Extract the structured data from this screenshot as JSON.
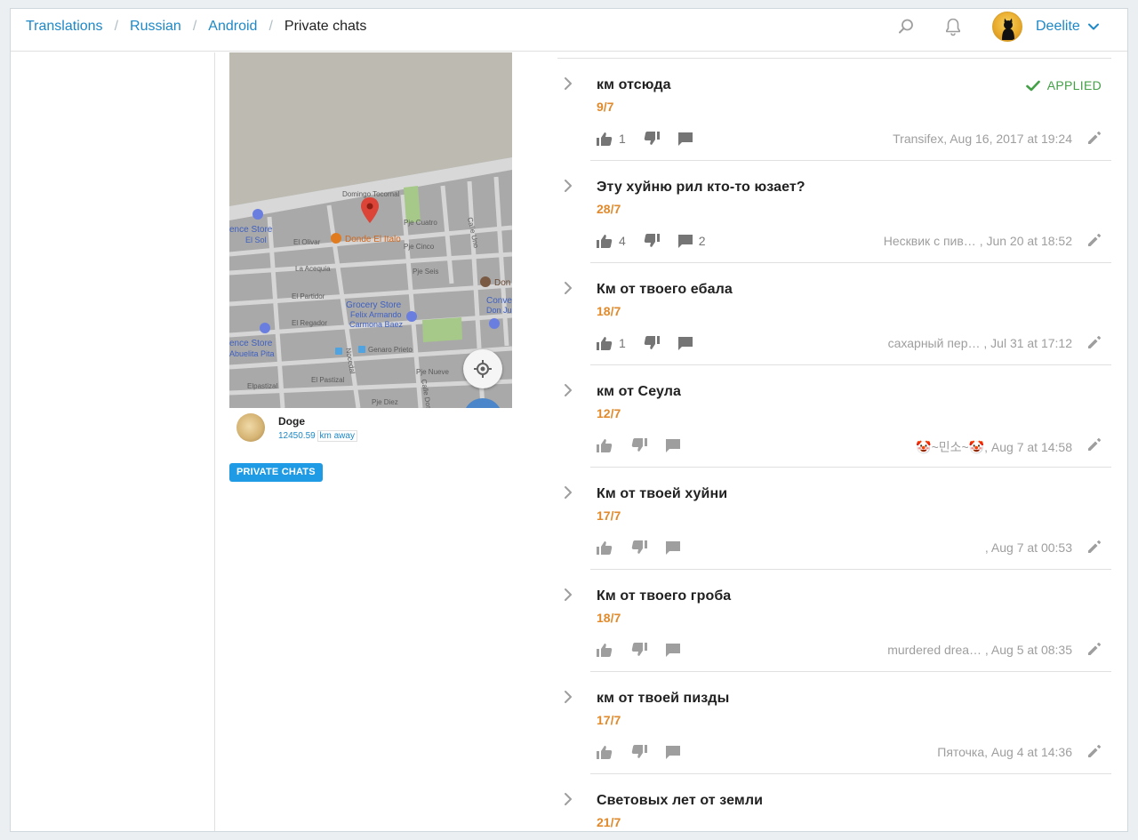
{
  "breadcrumb": {
    "items": [
      "Translations",
      "Russian",
      "Android"
    ],
    "current": "Private chats"
  },
  "header": {
    "search_icon": "search-icon",
    "notifications_icon": "bell-icon",
    "username": "Deelite"
  },
  "screenshot": {
    "map_labels": [
      "Domingo Tocornal",
      "Pje Cuatro",
      "ence Store",
      "El Sol",
      "El Olivar",
      "Donde El Italo",
      "Pje Cinco",
      "La Acequia",
      "Pje Seis",
      "Don",
      "El Partidor",
      "Conve",
      "Don Ju",
      "Grocery Store",
      "Felix Armando",
      "Carmona Baez",
      "El Regador",
      "ence Store",
      "Abuelita Pita",
      "Genaro Prieto",
      "Pje Nueve",
      "El Pastizal",
      "Elpastizal",
      "Pje Diez",
      "Calle Uno",
      "Calle Dos",
      "Nocedal"
    ],
    "contact_name": "Doge",
    "distance": "12450.59",
    "distance_unit": "km away"
  },
  "tag": "PRIVATE CHATS",
  "applied_label": "APPLIED",
  "suggestions": [
    {
      "text": "км отсюда",
      "count": "9/7",
      "upvotes": "1",
      "comments": "",
      "meta": "Transifex, Aug 16, 2017 at 19:24",
      "applied": true,
      "votes_dark": true
    },
    {
      "text": "Эту хуйню рил кто-то юзает?",
      "count": "28/7",
      "upvotes": "4",
      "comments": "2",
      "meta": "Несквик с пив… , Jun 20 at 18:52",
      "applied": false,
      "votes_dark": true
    },
    {
      "text": "Км от твоего ебала",
      "count": "18/7",
      "upvotes": "1",
      "comments": "",
      "meta": "сахарный пер… , Jul 31 at 17:12",
      "applied": false,
      "votes_dark": true
    },
    {
      "text": "км от Сеула",
      "count": "12/7",
      "upvotes": "",
      "comments": "",
      "meta": "🤡~민소~🤡, Aug 7 at 14:58",
      "applied": false,
      "votes_dark": false
    },
    {
      "text": "Км от твоей хуйни",
      "count": "17/7",
      "upvotes": "",
      "comments": "",
      "meta": ", Aug 7 at 00:53",
      "applied": false,
      "votes_dark": false
    },
    {
      "text": "Км от твоего гроба",
      "count": "18/7",
      "upvotes": "",
      "comments": "",
      "meta": "murdered drea… , Aug 5 at 08:35",
      "applied": false,
      "votes_dark": false
    },
    {
      "text": "км от твоей пизды",
      "count": "17/7",
      "upvotes": "",
      "comments": "",
      "meta": "Пяточка, Aug 4 at 14:36",
      "applied": false,
      "votes_dark": false
    },
    {
      "text": "Световых лет от земли",
      "count": "21/7",
      "upvotes": "",
      "comments": "",
      "meta": "",
      "applied": false,
      "votes_dark": false
    }
  ]
}
